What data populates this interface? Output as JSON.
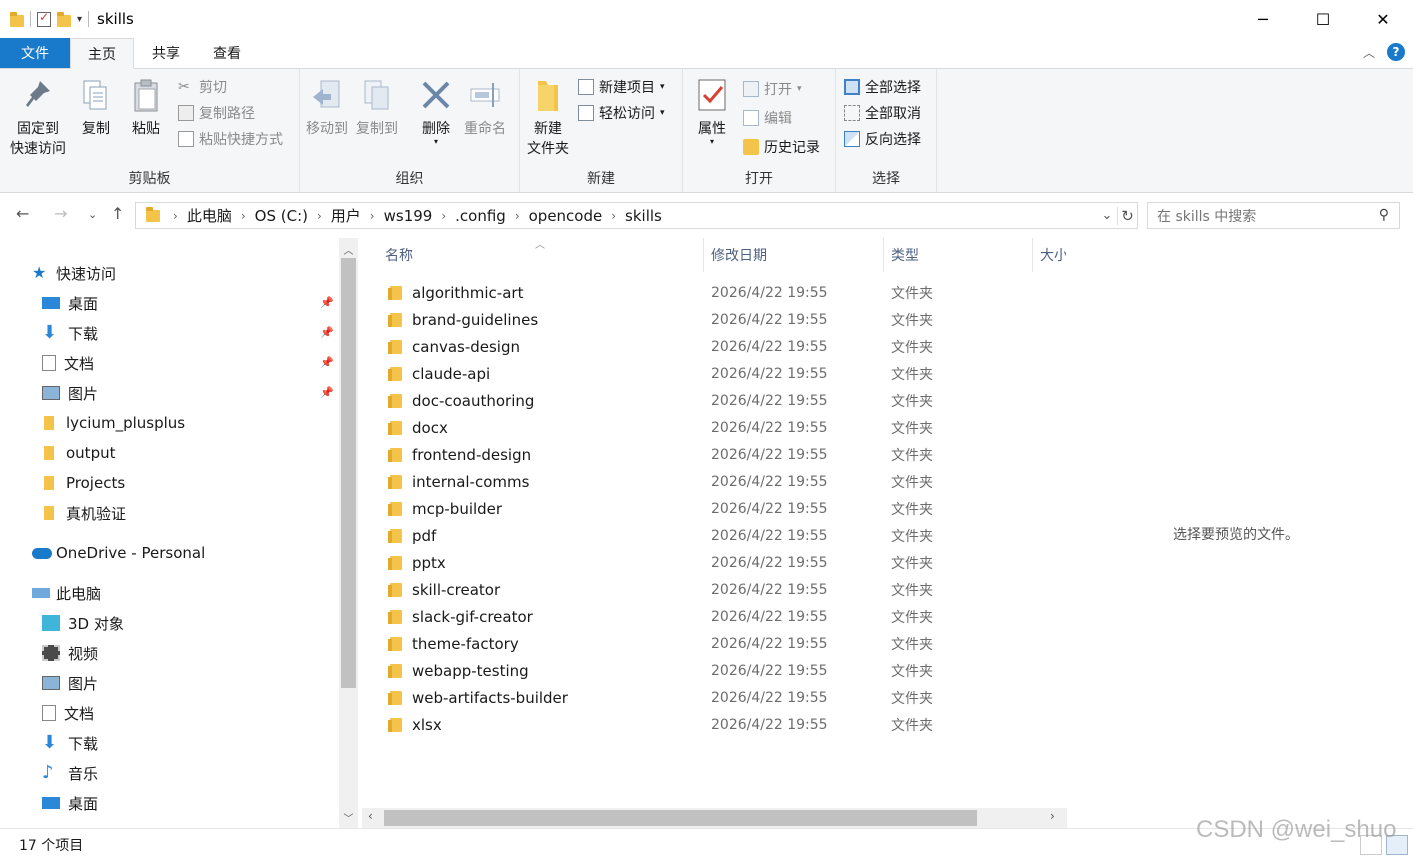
{
  "window": {
    "title": "skills",
    "controls": {
      "minimize": "─",
      "maximize": "☐",
      "close": "✕"
    }
  },
  "tabs": [
    "文件",
    "主页",
    "共享",
    "查看"
  ],
  "ribbon": {
    "clipboard": {
      "label": "剪贴板",
      "pin_l1": "固定到",
      "pin_l2": "快速访问",
      "copy": "复制",
      "paste": "粘贴",
      "cut": "剪切",
      "copy_path": "复制路径",
      "paste_shortcut": "粘贴快捷方式"
    },
    "organize": {
      "label": "组织",
      "move_to": "移动到",
      "copy_to": "复制到",
      "delete": "删除",
      "rename": "重命名"
    },
    "new": {
      "label": "新建",
      "new_folder_l1": "新建",
      "new_folder_l2": "文件夹",
      "new_item": "新建项目",
      "easy_access": "轻松访问"
    },
    "open": {
      "label": "打开",
      "properties": "属性",
      "open": "打开",
      "edit": "编辑",
      "history": "历史记录"
    },
    "select": {
      "label": "选择",
      "select_all": "全部选择",
      "select_none": "全部取消",
      "invert": "反向选择"
    }
  },
  "address": {
    "crumbs": [
      "此电脑",
      "OS (C:)",
      "用户",
      "ws199",
      ".config",
      "opencode",
      "skills"
    ]
  },
  "search": {
    "placeholder": "在 skills 中搜索"
  },
  "nav": {
    "quick_access": "快速访问",
    "quick_items": [
      "桌面",
      "下载",
      "文档",
      "图片",
      "lycium_plusplus",
      "output",
      "Projects",
      "真机验证"
    ],
    "onedrive": "OneDrive - Personal",
    "this_pc": "此电脑",
    "pc_items": [
      "3D 对象",
      "视频",
      "图片",
      "文档",
      "下载",
      "音乐",
      "桌面"
    ]
  },
  "columns": {
    "name": "名称",
    "date": "修改日期",
    "type": "类型",
    "size": "大小"
  },
  "files": [
    {
      "name": "algorithmic-art",
      "date": "2026/4/22 19:55",
      "type": "文件夹"
    },
    {
      "name": "brand-guidelines",
      "date": "2026/4/22 19:55",
      "type": "文件夹"
    },
    {
      "name": "canvas-design",
      "date": "2026/4/22 19:55",
      "type": "文件夹"
    },
    {
      "name": "claude-api",
      "date": "2026/4/22 19:55",
      "type": "文件夹"
    },
    {
      "name": "doc-coauthoring",
      "date": "2026/4/22 19:55",
      "type": "文件夹"
    },
    {
      "name": "docx",
      "date": "2026/4/22 19:55",
      "type": "文件夹"
    },
    {
      "name": "frontend-design",
      "date": "2026/4/22 19:55",
      "type": "文件夹"
    },
    {
      "name": "internal-comms",
      "date": "2026/4/22 19:55",
      "type": "文件夹"
    },
    {
      "name": "mcp-builder",
      "date": "2026/4/22 19:55",
      "type": "文件夹"
    },
    {
      "name": "pdf",
      "date": "2026/4/22 19:55",
      "type": "文件夹"
    },
    {
      "name": "pptx",
      "date": "2026/4/22 19:55",
      "type": "文件夹"
    },
    {
      "name": "skill-creator",
      "date": "2026/4/22 19:55",
      "type": "文件夹"
    },
    {
      "name": "slack-gif-creator",
      "date": "2026/4/22 19:55",
      "type": "文件夹"
    },
    {
      "name": "theme-factory",
      "date": "2026/4/22 19:55",
      "type": "文件夹"
    },
    {
      "name": "webapp-testing",
      "date": "2026/4/22 19:55",
      "type": "文件夹"
    },
    {
      "name": "web-artifacts-builder",
      "date": "2026/4/22 19:55",
      "type": "文件夹"
    },
    {
      "name": "xlsx",
      "date": "2026/4/22 19:55",
      "type": "文件夹"
    }
  ],
  "preview": {
    "message": "选择要预览的文件。"
  },
  "status": {
    "count": "17 个项目"
  },
  "watermark": "CSDN @wei_shuo",
  "colors": {
    "accent": "#1979ca",
    "folder": "#f3c34a",
    "header_text": "#4d6082"
  }
}
